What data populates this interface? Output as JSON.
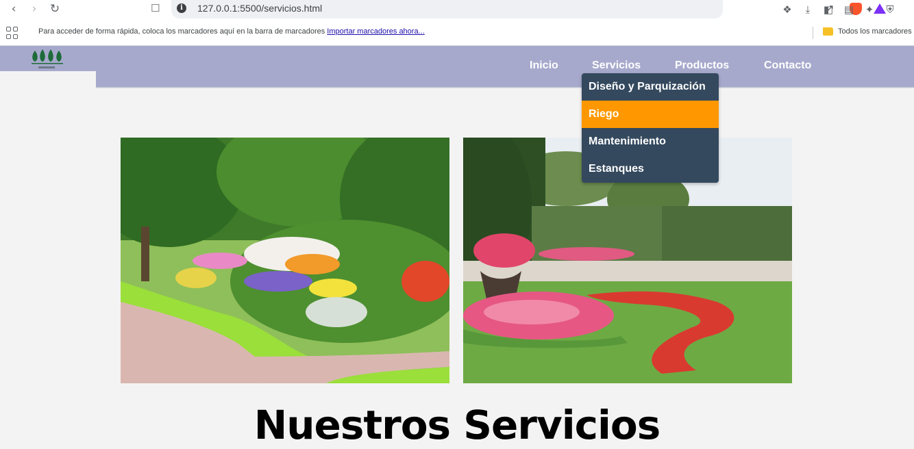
{
  "browser": {
    "url": "127.0.0.1:5500/servicios.html",
    "bookmarks_prompt": "Para acceder de forma rápida, coloca los marcadores aquí en la barra de marcadores",
    "bookmarks_import_link": "Importar marcadores ahora...",
    "all_bookmarks": "Todos los marcadores"
  },
  "nav": {
    "items": [
      "Inicio",
      "Servicios",
      "Productos",
      "Contacto"
    ]
  },
  "dropdown": {
    "items": [
      "Diseño y Parquización",
      "Riego",
      "Mantenimiento",
      "Estanques"
    ],
    "active_index": 1,
    "colors": {
      "background": "#34495e",
      "active": "#ff9800"
    }
  },
  "header": {
    "background": "#a7a9cc"
  },
  "gallery": {
    "images": [
      "garden-flowerbed-path-photo",
      "park-flower-garden-photo"
    ]
  },
  "page": {
    "section_title": "Nuestros Servicios"
  }
}
